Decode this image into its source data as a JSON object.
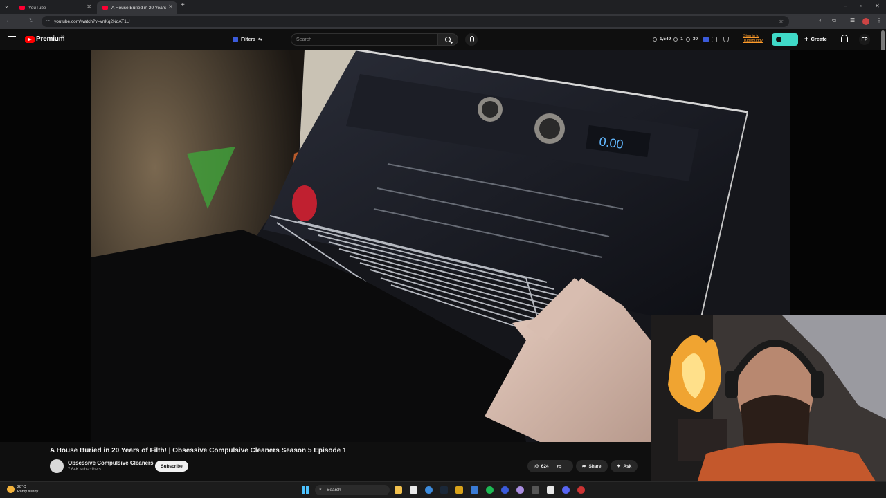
{
  "browser": {
    "tabs": [
      {
        "title": "YouTube",
        "active": false
      },
      {
        "title": "A House Buried in 20 Years",
        "active": true
      }
    ],
    "url": "youtube.com/watch?v=vnKq2NdAT1U",
    "new_tab_label": "+"
  },
  "masthead": {
    "logo_label": "Premium",
    "logo_region": "SA",
    "filters_label": "Filters",
    "search_placeholder": "Search",
    "stats": [
      "1,549",
      "1",
      "30"
    ],
    "sign_in_lines": [
      "Sign in to",
      "TubeBuddy"
    ],
    "create_label": "Create",
    "avatar_initials": "FP"
  },
  "video": {
    "title": "A House Buried in 20 Years of Filth! | Obsessive Compulsive Cleaners Season 5 Episode 1",
    "oven_display": "0.00"
  },
  "channel": {
    "name": "Obsessive Compulsive Cleaners",
    "subscribers": "7.64K subscribers",
    "subscribe_label": "Subscribe"
  },
  "actions": {
    "likes": "624",
    "share_label": "Share",
    "ask_label": "Ask"
  },
  "taskbar": {
    "temperature": "28°C",
    "weather": "Partly sunny",
    "search_label": "Search"
  },
  "colors": {
    "yt_red": "#ff0000",
    "tubebuddy_teal": "#3fd9c7",
    "signin_orange": "#ff9c2a"
  }
}
